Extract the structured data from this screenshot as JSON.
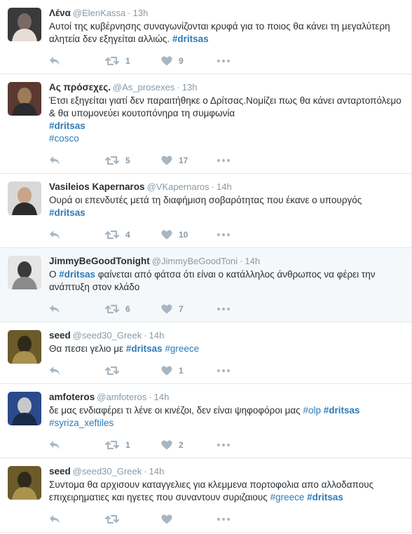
{
  "tweets": [
    {
      "name": "Λένα",
      "handle": "@ElenKassa",
      "time": "13h",
      "segments": [
        {
          "t": "Αυτοί της κυβέρνησης συναγωνίζονται κρυφά για το ποιος θα κάνει τη μεγαλύτερη αλητεία δεν εξηγείται αλλιώς. "
        },
        {
          "t": "#dritsas",
          "tag": true,
          "bold": true
        }
      ],
      "retweets": "1",
      "likes": "9",
      "highlight": false,
      "avatar_colors": [
        "#3a3a3a",
        "#7a6a66",
        "#e8dcd6"
      ]
    },
    {
      "name": "Ας πρόσεχες.",
      "handle": "@As_prosexes",
      "time": "13h",
      "segments": [
        {
          "t": "Έτσι εξηγείται γιατί δεν παραιτήθηκε ο Δρίτσας.Νομίζει πως θα κάνει ανταρτοπόλεμο & θα υπομονεύει κουτοπόνηρα τη συμφωνία"
        },
        {
          "br": true
        },
        {
          "t": "#dritsas",
          "tag": true,
          "bold": true
        },
        {
          "br": true
        },
        {
          "t": "#cosco",
          "tag": true
        }
      ],
      "retweets": "5",
      "likes": "17",
      "highlight": false,
      "avatar_colors": [
        "#5a3a30",
        "#9c7a5a",
        "#2c2a2e"
      ]
    },
    {
      "name": "Vasileios Kapernaros",
      "handle": "@VKapernaros",
      "time": "14h",
      "segments": [
        {
          "t": "Ουρά οι επενδυτές μετά τη διαφήμιση σοβαρότητας που έκανε ο υπουργός"
        },
        {
          "br": true
        },
        {
          "t": "#dritsas",
          "tag": true,
          "bold": true
        }
      ],
      "retweets": "4",
      "likes": "10",
      "highlight": false,
      "avatar_colors": [
        "#d8d8d8",
        "#c9a48a",
        "#2b2b2b"
      ]
    },
    {
      "name": "JimmyBeGoodTonight",
      "handle": "@JimmyBeGoodToni",
      "time": "14h",
      "segments": [
        {
          "t": "Ο "
        },
        {
          "t": "#dritsas",
          "tag": true,
          "bold": true
        },
        {
          "t": " φαίνεται από φάτσα ότι είναι ο κατάλληλος άνθρωπος να φέρει την ανάπτυξη στον κλάδο"
        }
      ],
      "retweets": "6",
      "likes": "7",
      "highlight": true,
      "avatar_colors": [
        "#e5e5e5",
        "#3a3a3a",
        "#8a8a8a"
      ]
    },
    {
      "name": "seed",
      "handle": "@seed30_Greek",
      "time": "14h",
      "segments": [
        {
          "t": "Θα πεσει γελιο με "
        },
        {
          "t": "#dritsas",
          "tag": true,
          "bold": true
        },
        {
          "t": " "
        },
        {
          "t": "#greece",
          "tag": true
        }
      ],
      "retweets": "",
      "likes": "1",
      "highlight": false,
      "avatar_colors": [
        "#6b5a2a",
        "#2e2a1a",
        "#a8924e"
      ]
    },
    {
      "name": "amfoteros",
      "handle": "@amfoteros",
      "time": "14h",
      "segments": [
        {
          "t": "δε μας ενδιαφέρει τι λένε οι κινέζοι, δεν είναι ψηφοφόροι μας "
        },
        {
          "t": "#olp",
          "tag": true
        },
        {
          "t": " "
        },
        {
          "t": "#dritsas",
          "tag": true,
          "bold": true
        },
        {
          "br": true
        },
        {
          "t": "#syriza_xeftiles",
          "tag": true
        }
      ],
      "retweets": "1",
      "likes": "2",
      "highlight": false,
      "avatar_colors": [
        "#2a4a8a",
        "#c8c8cc",
        "#1a2a4a"
      ]
    },
    {
      "name": "seed",
      "handle": "@seed30_Greek",
      "time": "14h",
      "segments": [
        {
          "t": "Συντομα θα αρχισουν καταγγελιες για κλεμμενα πορτοφολια απο αλλοδαπους επιχειρηματιες και ηγετες που συναντουν συριζαιους "
        },
        {
          "t": "#greece",
          "tag": true
        },
        {
          "t": " "
        },
        {
          "t": "#dritsas",
          "tag": true,
          "bold": true
        }
      ],
      "retweets": "",
      "likes": "",
      "highlight": false,
      "avatar_colors": [
        "#6b5a2a",
        "#2e2a1a",
        "#a8924e"
      ]
    }
  ],
  "icons": {
    "reply": "reply-icon",
    "retweet": "retweet-icon",
    "like": "heart-icon",
    "more": "more-dots-icon"
  },
  "colors": {
    "link": "#2b7bb9",
    "meta": "#8899a6",
    "icon": "#a8b6c2",
    "highlight_bg": "#f5f8fa"
  }
}
